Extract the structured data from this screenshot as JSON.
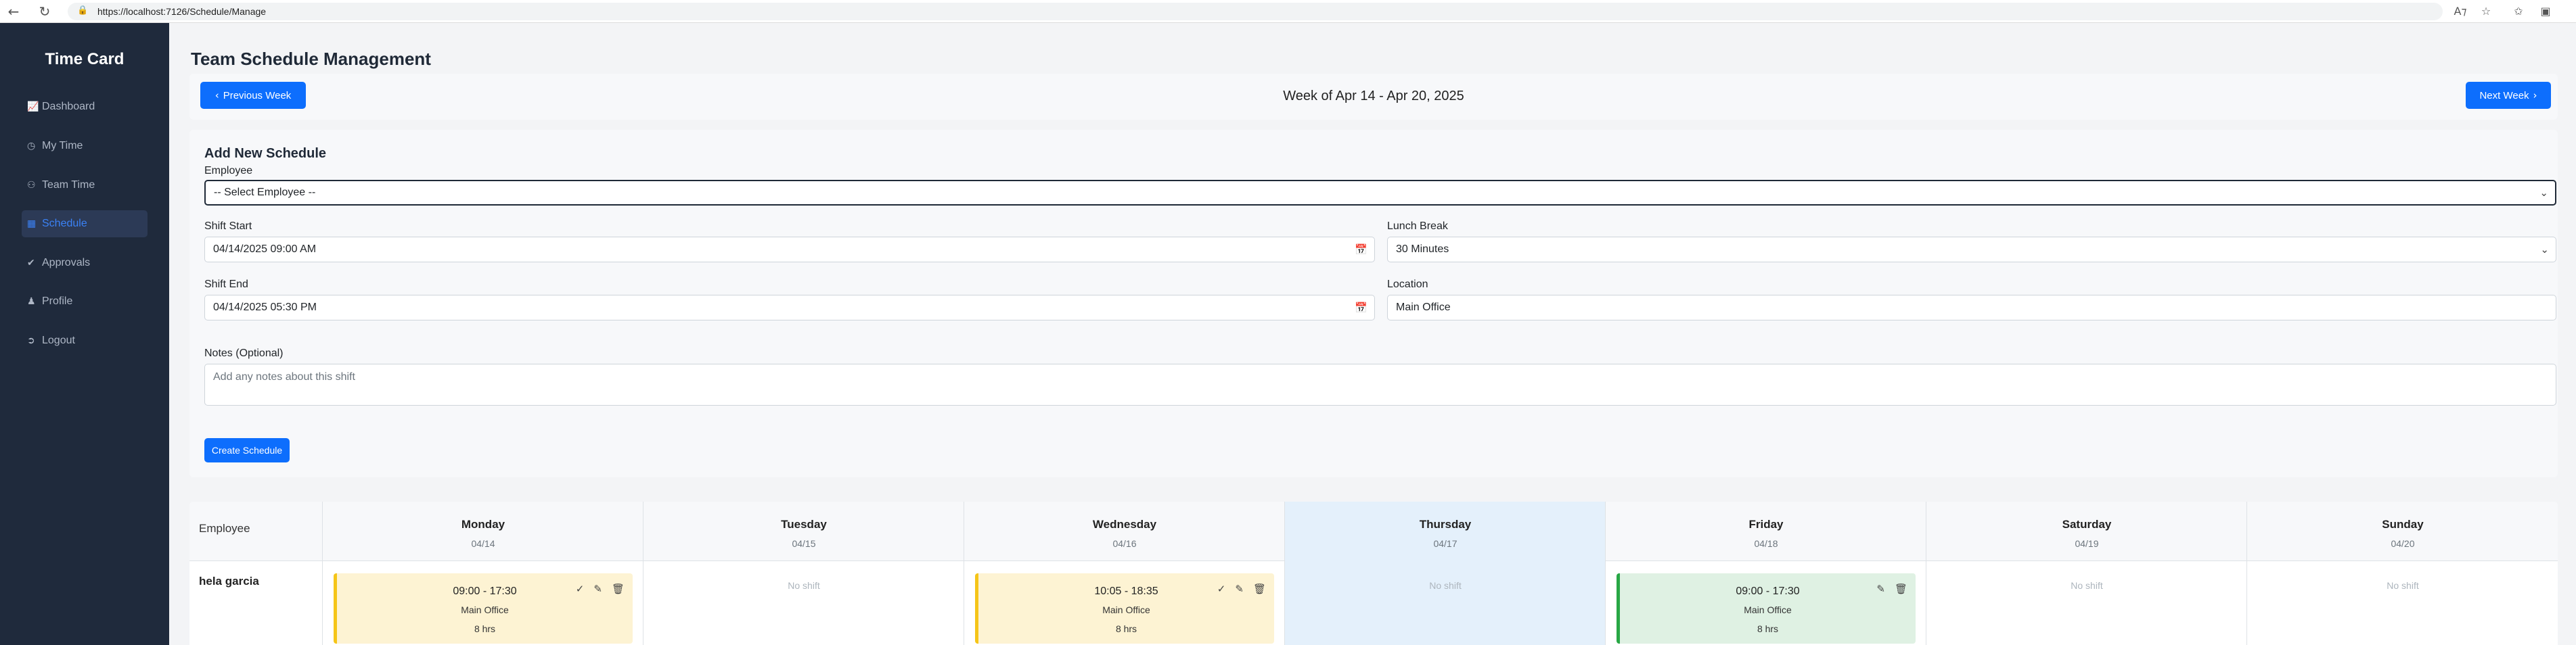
{
  "browser": {
    "url": "https://localhost:7126/Schedule/Manage"
  },
  "sidebar": {
    "brand": "Time Card",
    "items": [
      {
        "label": "Dashboard",
        "icon": "chart-icon"
      },
      {
        "label": "My Time",
        "icon": "clock-icon"
      },
      {
        "label": "Team Time",
        "icon": "users-icon"
      },
      {
        "label": "Schedule",
        "icon": "calendar-icon",
        "active": true
      },
      {
        "label": "Approvals",
        "icon": "check-circle-icon"
      },
      {
        "label": "Profile",
        "icon": "user-icon"
      },
      {
        "label": "Logout",
        "icon": "logout-icon"
      }
    ]
  },
  "page": {
    "title": "Team Schedule Management",
    "prev_week": "Previous Week",
    "next_week": "Next Week",
    "week_label": "Week of Apr 14 - Apr 20, 2025"
  },
  "form": {
    "title": "Add New Schedule",
    "employee_label": "Employee",
    "employee_value": "-- Select Employee --",
    "shift_start_label": "Shift Start",
    "shift_start_value": "04/14/2025 09:00 AM",
    "lunch_label": "Lunch Break",
    "lunch_value": "30 Minutes",
    "shift_end_label": "Shift End",
    "shift_end_value": "04/14/2025 05:30 PM",
    "location_label": "Location",
    "location_value": "Main Office",
    "notes_label": "Notes (Optional)",
    "notes_placeholder": "Add any notes about this shift",
    "submit_label": "Create Schedule"
  },
  "grid": {
    "employee_header": "Employee",
    "days": [
      {
        "name": "Monday",
        "date": "04/14"
      },
      {
        "name": "Tuesday",
        "date": "04/15"
      },
      {
        "name": "Wednesday",
        "date": "04/16"
      },
      {
        "name": "Thursday",
        "date": "04/17"
      },
      {
        "name": "Friday",
        "date": "04/18"
      },
      {
        "name": "Saturday",
        "date": "04/19"
      },
      {
        "name": "Sunday",
        "date": "04/20"
      }
    ],
    "no_shift": "No shift",
    "employee": "hela garcia",
    "shifts": {
      "monday": {
        "time": "09:00 - 17:30",
        "location": "Main Office",
        "hours": "8 hrs",
        "status": "pending"
      },
      "wednesday": {
        "time": "10:05 - 18:35",
        "location": "Main Office",
        "hours": "8 hrs",
        "status": "pending"
      },
      "friday": {
        "time": "09:00 - 17:30",
        "location": "Main Office",
        "hours": "8 hrs",
        "status": "approved"
      }
    }
  },
  "colors": {
    "sidebar_bg": "#1f2a3c",
    "primary": "#0d6efd",
    "pending": "#f5c518",
    "approved": "#28a745"
  }
}
